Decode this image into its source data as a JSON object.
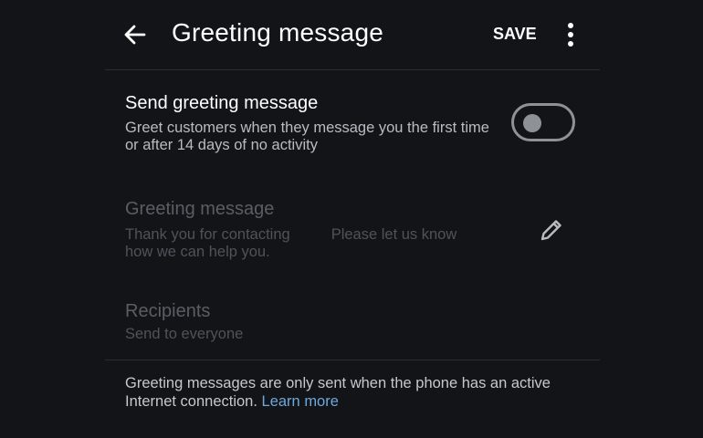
{
  "header": {
    "title": "Greeting message",
    "save_label": "SAVE",
    "back_icon": "arrow-left-icon",
    "more_icon": "more-vertical-icon"
  },
  "send_greeting": {
    "title": "Send greeting message",
    "subtitle": "Greet customers when they message you the first time or after 14 days of no activity",
    "enabled": false
  },
  "greeting_message": {
    "title": "Greeting message",
    "text_part1": "Thank you for contacting",
    "text_part2": "Please let us know",
    "text_part3": "how we can help you.",
    "edit_icon": "pencil-icon"
  },
  "recipients": {
    "title": "Recipients",
    "value": "Send to everyone"
  },
  "footer": {
    "note": "Greeting messages are only sent when the phone has an active Internet connection.",
    "link_label": "Learn more"
  },
  "colors": {
    "background": "#121418",
    "link": "#6fa8dc",
    "toggle_off": "#8e9196"
  }
}
